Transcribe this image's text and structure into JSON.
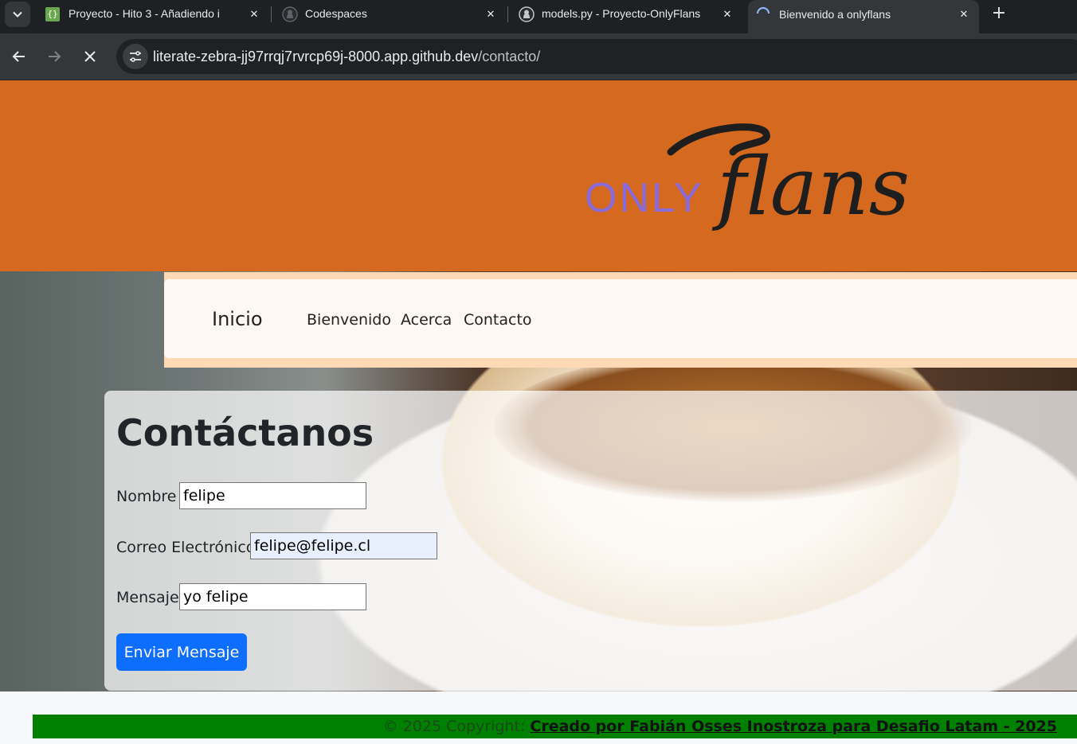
{
  "browser": {
    "tabs": [
      {
        "title": "Proyecto - Hito 3 - Añadiendo i",
        "favicon": "code-brackets-icon",
        "active": false
      },
      {
        "title": "Codespaces",
        "favicon": "github-icon",
        "active": false
      },
      {
        "title": "models.py - Proyecto-OnlyFlans",
        "favicon": "github-icon",
        "active": false
      },
      {
        "title": "Bienvenido a onlyflans",
        "favicon": "loading-spinner-icon",
        "active": true
      }
    ],
    "url_host": "literate-zebra-jj97rrqj7rvrcp69j-8000.app.github.dev",
    "url_path": "/contacto/"
  },
  "logo": {
    "only": "ONLY",
    "flans": "flans"
  },
  "nav": {
    "brand": "Inicio",
    "links": [
      "Bienvenido",
      "Acerca",
      "Contacto"
    ]
  },
  "contact": {
    "heading": "Contáctanos",
    "fields": [
      {
        "label": "Nombre",
        "value": "felipe"
      },
      {
        "label": "Correo Electrónico",
        "value": "felipe@felipe.cl"
      },
      {
        "label": "Mensaje",
        "value": "yo felipe"
      }
    ],
    "submit_label": "Enviar Mensaje"
  },
  "footer": {
    "copyright": "© 2025 Copyright: ",
    "credit_link": "Creado por Fabián Osses Inostroza para Desafio Latam - 2025"
  },
  "colors": {
    "header": "#d4691f",
    "navbar_bg": "#fff8f2",
    "primary_button": "#0d6efd",
    "footer": "#008000",
    "logo_only": "#8a6ad8"
  }
}
